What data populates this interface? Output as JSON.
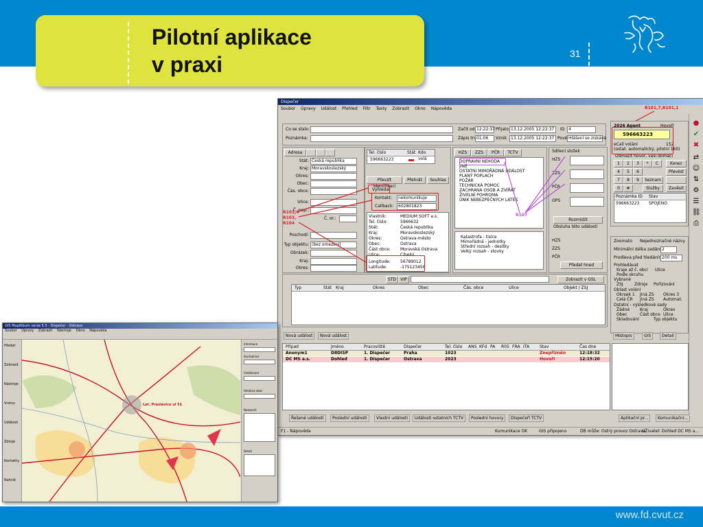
{
  "slide": {
    "title_line1": "Pilotní aplikace",
    "title_line2": "v praxi",
    "page_number": "31",
    "footer_url": "www.fd.cvut.cz",
    "band_color": "#0087cd",
    "title_box_color": "#dfe33d"
  },
  "app": {
    "window_title": "Dispečer",
    "menu": [
      "Soubor",
      "Úpravy",
      "Událost",
      "Přehled",
      "Filtr",
      "Texty",
      "Zobrazit",
      "Okno",
      "Nápověda"
    ],
    "call": {
      "caller_label": "Co se stalo:",
      "note_label": "Poznámka:",
      "from_label": "Začít od",
      "from_time": "12:22:37",
      "received_label": "Přijato",
      "received_value": "13.12.2005 12:22:37",
      "id_label": "ID",
      "id_value": "4",
      "record_label": "Zápis trvá",
      "record_value": "01:06",
      "created_label": "Vznik",
      "created_value": "13.12.2005 12:22:37",
      "reason_label": "Pověřil",
      "reason_value": "Hlášení se získává"
    },
    "address_tabs": [
      "Adresa",
      "",
      "",
      ""
    ],
    "address_fields": [
      {
        "label": "Stát:",
        "value": "Česká republika"
      },
      {
        "label": "Kraj:",
        "value": "Moravskoslezský"
      },
      {
        "label": "Okres:",
        "value": ""
      },
      {
        "label": "Obec:",
        "value": ""
      },
      {
        "label": "Čás. obce:",
        "value": ""
      },
      {
        "label": "Ulice:",
        "value": ""
      },
      {
        "label": "Č. pop.:",
        "value": ""
      },
      {
        "label": "Č. or.:",
        "value": ""
      },
      {
        "label": "Poschodí:",
        "value": ""
      },
      {
        "label": "Typ objektu:",
        "value": "(bez omezení)"
      },
      {
        "label": "Obrázek:",
        "value": ""
      },
      {
        "label": "Kraj:",
        "value": ""
      },
      {
        "label": "Okres:",
        "value": ""
      }
    ],
    "red_labels": [
      "R101,4",
      "R103,",
      "R104"
    ],
    "phone": {
      "col_phone": "Tel. číslo",
      "col_state": "Stát",
      "col_operator": "Kdo volá",
      "number": "596663223",
      "btn_identify": "Převzít identifikaci",
      "btn_play": "Přehrát",
      "btn_record": "Souhlas",
      "locate_label": "Vyhledat",
      "contact_label": "Kontakt:",
      "contact_value": "nekomunikuje",
      "callback_label": "Callback:",
      "callback_value": "602801823",
      "details": [
        {
          "k": "Vlastník:",
          "v": "MEDIUM SOFT a.s."
        },
        {
          "k": "Tel. číslo:",
          "v": "5966632"
        },
        {
          "k": "Stát:",
          "v": "Česká republika"
        },
        {
          "k": "Kraj:",
          "v": "Moravskoslezský"
        },
        {
          "k": "Okres:",
          "v": "Ostrava-město"
        },
        {
          "k": "Obec:",
          "v": "Ostrava"
        },
        {
          "k": "Část obce:",
          "v": "Moravská Ostrava"
        },
        {
          "k": "Ulice:",
          "v": "Cihelní"
        },
        {
          "k": "Longitude:",
          "v": "56789012"
        },
        {
          "k": "Latitude:",
          "v": "-175123456"
        }
      ]
    },
    "services_tabs": [
      "HZS",
      "ZZS",
      "PČR",
      "TCTV"
    ],
    "incident_tree": [
      "DOPRAVNÍ NEHODA",
      "JINÉ",
      "OSTATNÍ MIMOŘÁDNÁ UDÁLOST",
      "PLANÝ POPLACH",
      "POŽÁR",
      "TECHNICKÁ POMOC",
      "ZACHRANA OSOB A ZVÍŘAT",
      "ŽIVELNÍ POHROMA",
      "ÚNIK NEBEZPEČNÝCH LÁTEK"
    ],
    "severity_list": [
      "Katastrofa - tisíce",
      "Mimořádná - jednotky",
      "Střední rozsah - desítky",
      "Velký rozsah - stovky"
    ],
    "sharing_title": "Sdílení složek",
    "sharing_rows": [
      "HZS",
      "ZZS",
      "PČR",
      "OPS"
    ],
    "r107": "R107",
    "r1017": "R101,7,R101,1",
    "btn_coordinate": "Rozmístit",
    "chk_contact": "Obsluha této události",
    "btn_hint": "Předat hned",
    "search_tabs": [
      "STD",
      "VIP"
    ],
    "search_btn": "Zobrazit v GSL",
    "result_cols": [
      "Typ",
      "Stát",
      "Kraj",
      "Okres",
      "Obec",
      "Čás. obce",
      "Ulice",
      "Objekt / ZSJ"
    ],
    "bottom_tabs": [
      "Nová událost",
      "Nová událost"
    ],
    "events_cols": [
      "Případ",
      "Jméno",
      "Pracoviště",
      "Dispečer",
      "Tel. číslo",
      "ANS",
      "KFd",
      "PA",
      "R05",
      "FRA",
      "ITA",
      "Stav",
      "Čas dne"
    ],
    "events": [
      {
        "case": "Anonym1",
        "name": "D8DISP",
        "place": "1. Dispečer",
        "disp": "Praha",
        "tel": "1023",
        "state": "Znepřízněn",
        "time": "12:18:32"
      },
      {
        "case": "DC MS a.s.",
        "name": "Dohled",
        "place": "1. Dispečer",
        "disp": "Ostrava",
        "tel": "2023",
        "state": "Hovoří",
        "time": "12:15:20"
      }
    ],
    "footer_tabs": [
      "Řešené události",
      "Poslední události",
      "Vlastní události",
      "Události ostatních TCTV",
      "Poslední hovory",
      "Dispečeři TCTV"
    ],
    "agent": {
      "title": "2026 Agent",
      "status": "Hovoří",
      "number": "596663223",
      "call_info": "eCall volání",
      "auto_line": "(ostat. automatický, pilotní 160)",
      "count": "152",
      "keypad_label": "Odmažit hovor, vaši domácí",
      "keys": [
        "1",
        "2",
        "3",
        "*",
        "C",
        "4",
        "5",
        "6",
        "7",
        "8",
        "9",
        "0",
        "#"
      ],
      "btn_finish": "Konec",
      "btn_transfer": "Převést",
      "btn_list": "Seznam",
      "btn_services": "Služby",
      "btn_back": "Zavěsit",
      "contacts_header": [
        "Poznámka ID",
        "Stav"
      ],
      "contacts": [
        {
          "id": "596663223",
          "state": "SPOJENO"
        }
      ],
      "settings": {
        "c_zoom": "Zoomato",
        "c_hidden": "Nejednoznačné názvy",
        "min_len_label": "Minimální délka zadání:",
        "min_len": "2",
        "pre_label": "Prodleva před hledáním:",
        "pre_value": "200 ms",
        "search_label": "Prohledávat",
        "opt1": "Kraje až č. obcí",
        "opt2": "Ulice",
        "opt3": "Podle okruhu",
        "sel_label": "Vybrané",
        "opt4": "ZSJ",
        "opt5": "Zdroje",
        "opt6": "Pořizování",
        "extent_label": "Oblast volání",
        "opt7": "Okrsek 1",
        "opt8": "Jiná ZS",
        "opt9": "Okres 3",
        "opt10": "Celá ČR",
        "opt11": "Jiná ZS",
        "opt12": "Automat.",
        "sort_label": "Ostatní - výsledkové sady",
        "opt13": "Žádné",
        "opt14": "Kraj",
        "opt15": "Okres",
        "opt16": "Obec",
        "opt17": "Část obce",
        "opt18": "Ulice",
        "opt19": "Skladování",
        "opt20": "Typ objektu"
      },
      "tabs": [
        "Místopis",
        "GIS",
        "Detail"
      ],
      "bottom_tabs": [
        "Aplikační pr...",
        "Komunikační..."
      ]
    },
    "status": [
      "F1 - Nápověda",
      "Kumunikace OK",
      "GIS připojeno",
      "DB může: Ostrý provoz Ostrava",
      "UŽivatel: Dohled DC MS a..."
    ]
  },
  "map": {
    "window_title": "GIS MapAlbum verze 5.3 - Dispečer - Ostrava",
    "menu": [
      "Soubor",
      "Úpravy",
      "Zobrazit",
      "Nástroje",
      "Okno",
      "Nápověda"
    ],
    "left_items": [
      "Hledat",
      "Zobrazit",
      "Nástroje",
      "Vrstvy",
      "Události",
      "Zdroje",
      "Kontakty",
      "Nahrát"
    ],
    "right_labels": [
      "Informace",
      "Souřadnice",
      "Vzdálenost",
      "Hledaná obec",
      "Nalezené",
      "Detail"
    ],
    "pin_text": "Lat. Praslavice ul 51"
  }
}
